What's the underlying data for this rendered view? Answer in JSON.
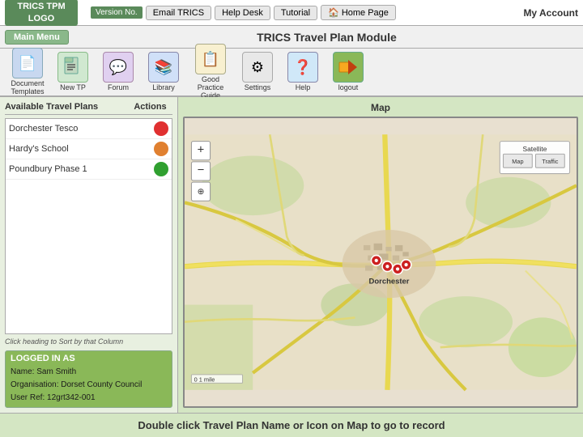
{
  "header": {
    "version_label": "Version No.",
    "email_trics_label": "Email TRICS",
    "help_desk_label": "Help Desk",
    "tutorial_label": "Tutorial",
    "home_page_label": "Home Page",
    "my_account_label": "My Account",
    "main_menu_label": "Main Menu",
    "module_title": "TRICS Travel Plan Module"
  },
  "icons": [
    {
      "id": "doc-templates",
      "label": "Document\nTemplates",
      "type": "doc",
      "symbol": "📄"
    },
    {
      "id": "new-tp",
      "label": "New TP",
      "type": "newtp",
      "symbol": "➕"
    },
    {
      "id": "forum",
      "label": "Forum",
      "type": "forum",
      "symbol": "💬"
    },
    {
      "id": "library",
      "label": "Library",
      "type": "library",
      "symbol": "📚"
    },
    {
      "id": "good-practice-guide",
      "label": "Good\nPractice\nGuide",
      "type": "gpg",
      "symbol": "📋"
    },
    {
      "id": "settings",
      "label": "Settings",
      "type": "settings",
      "symbol": "⚙"
    },
    {
      "id": "help",
      "label": "Help",
      "type": "help",
      "symbol": "❓"
    },
    {
      "id": "logout",
      "label": "logout",
      "type": "logout",
      "symbol": "🚪"
    }
  ],
  "left_panel": {
    "travel_plans_col": "Available Travel Plans",
    "actions_col": "Actions",
    "plans": [
      {
        "name": "Dorchester Tesco",
        "status": "red"
      },
      {
        "name": "Hardy's School",
        "status": "orange"
      },
      {
        "name": "Poundbury Phase 1",
        "status": "green"
      }
    ],
    "sort_hint": "Click heading to Sort by that Column",
    "logged_in_title": "LOGGED IN AS",
    "name_label": "Name: Sam Smith",
    "org_label": "Organisation: Dorset County Council",
    "ref_label": "User Ref: 12grt342-001"
  },
  "map": {
    "title": "Map"
  },
  "bottom": {
    "text": "Double click Travel Plan Name or Icon on Map to go to record"
  },
  "logo": {
    "line1": "TRICS TPM",
    "line2": "LOGO"
  }
}
